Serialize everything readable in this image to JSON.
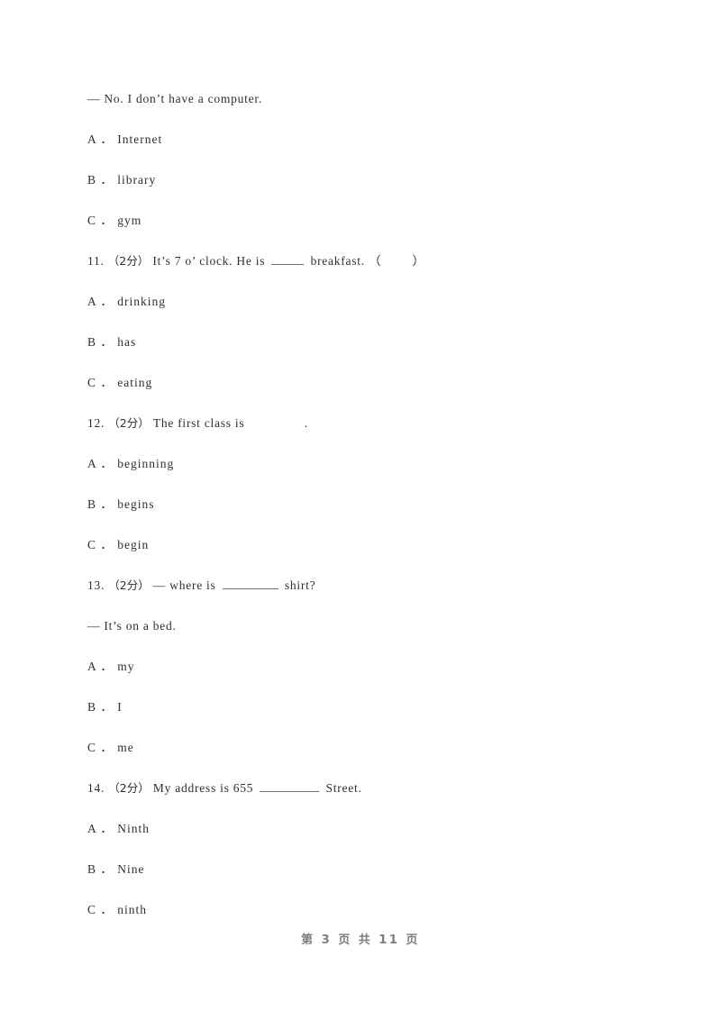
{
  "document": {
    "page_label": "第 3 页 共 11 页",
    "page_number": "3",
    "total_pages": "11",
    "ink_color": "#2f2f2f",
    "footer_color": "#7d7d7d",
    "background_color": "#ffffff"
  },
  "lines": [
    {
      "id": "q10_answer",
      "text": "— No. I don’t have a computer."
    },
    {
      "id": "q10_opt_a",
      "text": "A ． Internet"
    },
    {
      "id": "q10_opt_b",
      "text": "B ． library"
    },
    {
      "id": "q10_opt_c",
      "text": "C ． gym"
    }
  ],
  "questions": [
    {
      "number": "11.",
      "marks": "（2分）",
      "stem_before": "It’s 7 o’ clock. He is",
      "stem_after": "breakfast. （",
      "stem_tail": "）",
      "blank_style": "short",
      "extra_line": null,
      "options": [
        {
          "letter": "A ．",
          "text": "drinking"
        },
        {
          "letter": "B ．",
          "text": "has"
        },
        {
          "letter": "C ．",
          "text": "eating"
        }
      ]
    },
    {
      "number": "12.",
      "marks": "（2分）",
      "stem_before": "The first class is",
      "stem_after": ".",
      "stem_tail": "",
      "blank_style": "none",
      "extra_line": null,
      "options": [
        {
          "letter": "A ．",
          "text": "beginning"
        },
        {
          "letter": "B ．",
          "text": "begins"
        },
        {
          "letter": "C ．",
          "text": "begin"
        }
      ]
    },
    {
      "number": "13.",
      "marks": "（2分）",
      "stem_before": "— where is",
      "stem_after": "shirt?",
      "stem_tail": "",
      "blank_style": "med",
      "extra_line": "— It’s on a bed.",
      "options": [
        {
          "letter": "A ．",
          "text": "my"
        },
        {
          "letter": "B ．",
          "text": "I"
        },
        {
          "letter": "C ．",
          "text": "me"
        }
      ]
    },
    {
      "number": "14.",
      "marks": "（2分）",
      "stem_before": "My address is 655",
      "stem_after": "Street.",
      "stem_tail": "",
      "blank_style": "long",
      "extra_line": null,
      "options": [
        {
          "letter": "A ．",
          "text": "Ninth"
        },
        {
          "letter": "B ．",
          "text": "Nine"
        },
        {
          "letter": "C ．",
          "text": "ninth"
        }
      ]
    }
  ]
}
